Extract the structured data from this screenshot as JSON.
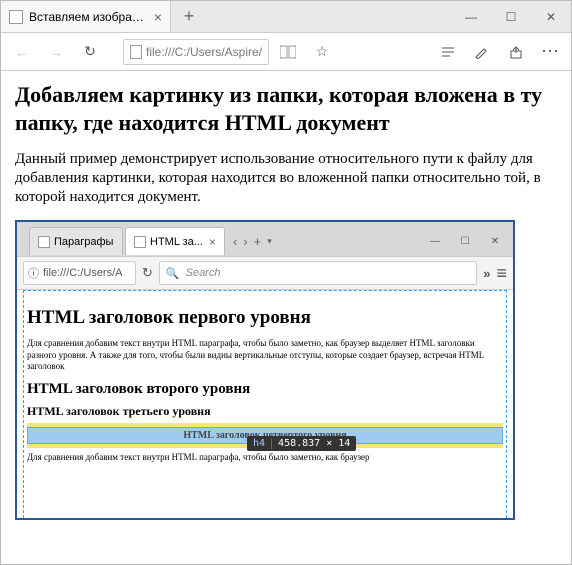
{
  "outer": {
    "tab_title": "Вставляем изображени",
    "address": "file:///C:/Users/Aspire/",
    "toolbar": {
      "back": "←",
      "forward": "→",
      "refresh": "↻",
      "reader": "📖",
      "favorite": "☆",
      "annotate": "✎",
      "share": "⇪",
      "more": "⋯"
    },
    "win": {
      "min": "—",
      "max": "☐",
      "close": "✕"
    }
  },
  "page": {
    "h1": "Добавляем картинку из папки, которая вложена в ту папку, где находится HTML документ",
    "p1": "Данный пример демонстрирует использование относительного пути к файлу для добавления картинки, которая находится во вложенной папки относительно той, в которой находится документ."
  },
  "inner": {
    "tabs": [
      {
        "title": "Параграфы ..."
      },
      {
        "title": "HTML за..."
      }
    ],
    "nav": {
      "back": "‹",
      "forward": "›",
      "new": "+",
      "drop": "▾"
    },
    "win": {
      "min": "—",
      "max": "☐",
      "close": "✕"
    },
    "addr_info": "ⓘ",
    "address": "file:///C:/Users/A",
    "refresh": "↻",
    "search_icon": "🔍",
    "search_placeholder": "Search",
    "overflow": "»",
    "menu": "≡",
    "content": {
      "h1": "HTML заголовок первого уровня",
      "p1": "Для сравнения добавим текст внутри HTML параграфа, чтобы было заметно, как браузер выделяет HTML заголовки разного уровня. А также для того, чтобы были видны вертикальные отступы, которые создает браузер, встречая HTML заголовок",
      "h2": "HTML заголовок второго уровня",
      "h3": "HTML заголовок третьего уровня",
      "h4": "HTML заголовок четвертого уровня",
      "p2": "Для сравнения добавим текст внутри HTML параграфа, чтобы было заметно, как браузер"
    },
    "tooltip": {
      "tag": "h4",
      "dims": "458.837 × 14"
    }
  }
}
